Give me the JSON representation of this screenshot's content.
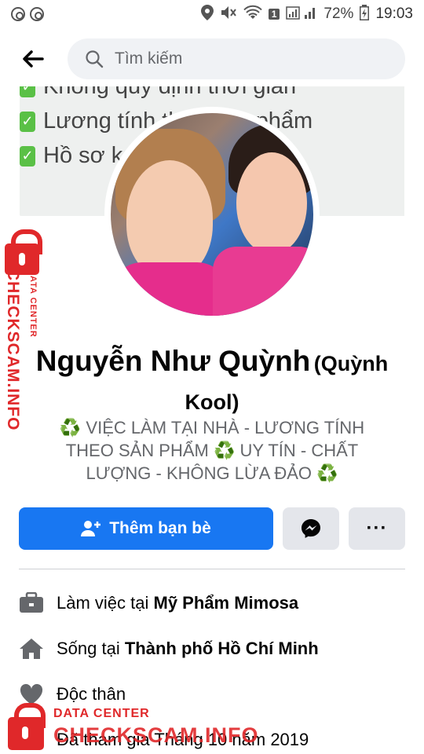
{
  "status_bar": {
    "battery": "72%",
    "time": "19:03",
    "sim_badge": "1"
  },
  "header": {
    "search_placeholder": "Tìm kiếm"
  },
  "cover": {
    "lines": [
      "Không quy định thời gian",
      "Lương tính theo sản phẩm",
      "Hồ sơ k... ...ng cấp"
    ]
  },
  "profile": {
    "name": "Nguyễn Như Quỳnh",
    "alternate_name": "(Quỳnh Kool)",
    "bio_line_1": "♻️ VIỆC LÀM TẠI NHÀ - LƯƠNG TÍNH",
    "bio_line_2": "THEO SẢN PHẨM ♻️ UY TÍN - CHẤT",
    "bio_line_3": "LƯỢNG - KHÔNG LỪA ĐẢO ♻️"
  },
  "actions": {
    "add_friend_label": "Thêm bạn bè",
    "more_label": "···"
  },
  "info": {
    "work_prefix": "Làm việc tại ",
    "work_value": "Mỹ Phẩm Mimosa",
    "live_prefix": "Sống tại ",
    "live_value": "Thành phố Hồ Chí Minh",
    "relationship": "Độc thân",
    "joined": "Đã tham gia Tháng 10 năm 2019"
  },
  "watermark": {
    "small": "DATA CENTER",
    "big": "CHECKSCAM.INFO"
  },
  "colors": {
    "accent": "#1877f2",
    "watermark": "#e0282a",
    "recycle": "#3fae3b"
  }
}
